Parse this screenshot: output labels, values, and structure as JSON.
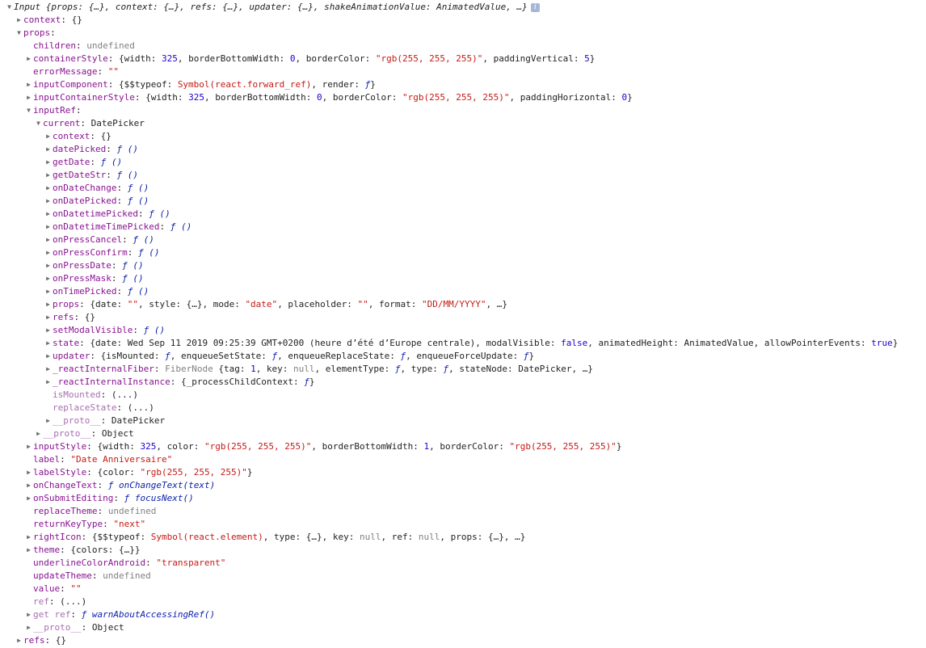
{
  "rows": [
    {
      "d": 0,
      "a": "down",
      "tokens": [
        [
          "i",
          "Input {props: {…}, context: {…}, refs: {…}, updater: {…}, shakeAnimationValue: AnimatedValue, …}"
        ]
      ],
      "info": "i"
    },
    {
      "d": 1,
      "a": "right",
      "tokens": [
        [
          "k",
          "context"
        ],
        [
          "p",
          ": {}"
        ]
      ]
    },
    {
      "d": 1,
      "a": "down",
      "tokens": [
        [
          "k",
          "props"
        ],
        [
          "p",
          ":"
        ]
      ]
    },
    {
      "d": 2,
      "a": "",
      "tokens": [
        [
          "k",
          "children"
        ],
        [
          "p",
          ": "
        ],
        [
          "u",
          "undefined"
        ]
      ]
    },
    {
      "d": 2,
      "a": "right",
      "tokens": [
        [
          "k",
          "containerStyle"
        ],
        [
          "p",
          ": {width: "
        ],
        [
          "n",
          "325"
        ],
        [
          "p",
          ", borderBottomWidth: "
        ],
        [
          "n",
          "0"
        ],
        [
          "p",
          ", borderColor: "
        ],
        [
          "s",
          "\"rgb(255, 255, 255)\""
        ],
        [
          "p",
          ", paddingVertical: "
        ],
        [
          "n",
          "5"
        ],
        [
          "p",
          "}"
        ]
      ]
    },
    {
      "d": 2,
      "a": "",
      "tokens": [
        [
          "k",
          "errorMessage"
        ],
        [
          "p",
          ": "
        ],
        [
          "s",
          "\"\""
        ]
      ]
    },
    {
      "d": 2,
      "a": "right",
      "tokens": [
        [
          "k",
          "inputComponent"
        ],
        [
          "p",
          ": {$$typeof: "
        ],
        [
          "s",
          "Symbol(react.forward_ref)"
        ],
        [
          "p",
          ", render: "
        ],
        [
          "f",
          "ƒ"
        ],
        [
          "p",
          "}"
        ]
      ]
    },
    {
      "d": 2,
      "a": "right",
      "tokens": [
        [
          "k",
          "inputContainerStyle"
        ],
        [
          "p",
          ": {width: "
        ],
        [
          "n",
          "325"
        ],
        [
          "p",
          ", borderBottomWidth: "
        ],
        [
          "n",
          "0"
        ],
        [
          "p",
          ", borderColor: "
        ],
        [
          "s",
          "\"rgb(255, 255, 255)\""
        ],
        [
          "p",
          ", paddingHorizontal: "
        ],
        [
          "n",
          "0"
        ],
        [
          "p",
          "}"
        ]
      ]
    },
    {
      "d": 2,
      "a": "down",
      "tokens": [
        [
          "k",
          "inputRef"
        ],
        [
          "p",
          ":"
        ]
      ]
    },
    {
      "d": 3,
      "a": "down",
      "tokens": [
        [
          "k",
          "current"
        ],
        [
          "p",
          ": DatePicker"
        ]
      ]
    },
    {
      "d": 4,
      "a": "right",
      "tokens": [
        [
          "k",
          "context"
        ],
        [
          "p",
          ": {}"
        ]
      ]
    },
    {
      "d": 4,
      "a": "right",
      "tokens": [
        [
          "k",
          "datePicked"
        ],
        [
          "p",
          ": "
        ],
        [
          "f",
          "ƒ ()"
        ]
      ]
    },
    {
      "d": 4,
      "a": "right",
      "tokens": [
        [
          "k",
          "getDate"
        ],
        [
          "p",
          ": "
        ],
        [
          "f",
          "ƒ ()"
        ]
      ]
    },
    {
      "d": 4,
      "a": "right",
      "tokens": [
        [
          "k",
          "getDateStr"
        ],
        [
          "p",
          ": "
        ],
        [
          "f",
          "ƒ ()"
        ]
      ]
    },
    {
      "d": 4,
      "a": "right",
      "tokens": [
        [
          "k",
          "onDateChange"
        ],
        [
          "p",
          ": "
        ],
        [
          "f",
          "ƒ ()"
        ]
      ]
    },
    {
      "d": 4,
      "a": "right",
      "tokens": [
        [
          "k",
          "onDatePicked"
        ],
        [
          "p",
          ": "
        ],
        [
          "f",
          "ƒ ()"
        ]
      ]
    },
    {
      "d": 4,
      "a": "right",
      "tokens": [
        [
          "k",
          "onDatetimePicked"
        ],
        [
          "p",
          ": "
        ],
        [
          "f",
          "ƒ ()"
        ]
      ]
    },
    {
      "d": 4,
      "a": "right",
      "tokens": [
        [
          "k",
          "onDatetimeTimePicked"
        ],
        [
          "p",
          ": "
        ],
        [
          "f",
          "ƒ ()"
        ]
      ]
    },
    {
      "d": 4,
      "a": "right",
      "tokens": [
        [
          "k",
          "onPressCancel"
        ],
        [
          "p",
          ": "
        ],
        [
          "f",
          "ƒ ()"
        ]
      ]
    },
    {
      "d": 4,
      "a": "right",
      "tokens": [
        [
          "k",
          "onPressConfirm"
        ],
        [
          "p",
          ": "
        ],
        [
          "f",
          "ƒ ()"
        ]
      ]
    },
    {
      "d": 4,
      "a": "right",
      "tokens": [
        [
          "k",
          "onPressDate"
        ],
        [
          "p",
          ": "
        ],
        [
          "f",
          "ƒ ()"
        ]
      ]
    },
    {
      "d": 4,
      "a": "right",
      "tokens": [
        [
          "k",
          "onPressMask"
        ],
        [
          "p",
          ": "
        ],
        [
          "f",
          "ƒ ()"
        ]
      ]
    },
    {
      "d": 4,
      "a": "right",
      "tokens": [
        [
          "k",
          "onTimePicked"
        ],
        [
          "p",
          ": "
        ],
        [
          "f",
          "ƒ ()"
        ]
      ]
    },
    {
      "d": 4,
      "a": "right",
      "tokens": [
        [
          "k",
          "props"
        ],
        [
          "p",
          ": {date: "
        ],
        [
          "s",
          "\"\""
        ],
        [
          "p",
          ", style: {…}, mode: "
        ],
        [
          "s",
          "\"date\""
        ],
        [
          "p",
          ", placeholder: "
        ],
        [
          "s",
          "\"\""
        ],
        [
          "p",
          ", format: "
        ],
        [
          "s",
          "\"DD/MM/YYYY\""
        ],
        [
          "p",
          ", …}"
        ]
      ]
    },
    {
      "d": 4,
      "a": "right",
      "tokens": [
        [
          "k",
          "refs"
        ],
        [
          "p",
          ": {}"
        ]
      ]
    },
    {
      "d": 4,
      "a": "right",
      "tokens": [
        [
          "k",
          "setModalVisible"
        ],
        [
          "p",
          ": "
        ],
        [
          "f",
          "ƒ ()"
        ]
      ]
    },
    {
      "d": 4,
      "a": "right",
      "tokens": [
        [
          "k",
          "state"
        ],
        [
          "p",
          ": {date: Wed Sep 11 2019 09:25:39 GMT+0200 (heure d’été d’Europe centrale), modalVisible: "
        ],
        [
          "b",
          "false"
        ],
        [
          "p",
          ", animatedHeight: AnimatedValue, allowPointerEvents: "
        ],
        [
          "b",
          "true"
        ],
        [
          "p",
          "}"
        ]
      ]
    },
    {
      "d": 4,
      "a": "right",
      "tokens": [
        [
          "k",
          "updater"
        ],
        [
          "p",
          ": {isMounted: "
        ],
        [
          "f",
          "ƒ"
        ],
        [
          "p",
          ", enqueueSetState: "
        ],
        [
          "f",
          "ƒ"
        ],
        [
          "p",
          ", enqueueReplaceState: "
        ],
        [
          "f",
          "ƒ"
        ],
        [
          "p",
          ", enqueueForceUpdate: "
        ],
        [
          "f",
          "ƒ"
        ],
        [
          "p",
          "}"
        ]
      ]
    },
    {
      "d": 4,
      "a": "right",
      "tokens": [
        [
          "k",
          "_reactInternalFiber"
        ],
        [
          "p",
          ": "
        ],
        [
          "u",
          "FiberNode"
        ],
        [
          "p",
          " {tag: "
        ],
        [
          "n",
          "1"
        ],
        [
          "p",
          ", key: "
        ],
        [
          "u",
          "null"
        ],
        [
          "p",
          ", elementType: "
        ],
        [
          "f",
          "ƒ"
        ],
        [
          "p",
          ", type: "
        ],
        [
          "f",
          "ƒ"
        ],
        [
          "p",
          ", stateNode: DatePicker, …}"
        ]
      ]
    },
    {
      "d": 4,
      "a": "right",
      "tokens": [
        [
          "k",
          "_reactInternalInstance"
        ],
        [
          "p",
          ": {_processChildContext: "
        ],
        [
          "f",
          "ƒ"
        ],
        [
          "p",
          "}"
        ]
      ]
    },
    {
      "d": 4,
      "a": "",
      "tokens": [
        [
          "kd",
          "isMounted"
        ],
        [
          "p",
          ": (...)"
        ]
      ]
    },
    {
      "d": 4,
      "a": "",
      "tokens": [
        [
          "kd",
          "replaceState"
        ],
        [
          "p",
          ": (...)"
        ]
      ]
    },
    {
      "d": 4,
      "a": "right",
      "tokens": [
        [
          "kd",
          "__proto__"
        ],
        [
          "p",
          ": DatePicker"
        ]
      ]
    },
    {
      "d": 3,
      "a": "right",
      "tokens": [
        [
          "kd",
          "__proto__"
        ],
        [
          "p",
          ": Object"
        ]
      ]
    },
    {
      "d": 2,
      "a": "right",
      "tokens": [
        [
          "k",
          "inputStyle"
        ],
        [
          "p",
          ": {width: "
        ],
        [
          "n",
          "325"
        ],
        [
          "p",
          ", color: "
        ],
        [
          "s",
          "\"rgb(255, 255, 255)\""
        ],
        [
          "p",
          ", borderBottomWidth: "
        ],
        [
          "n",
          "1"
        ],
        [
          "p",
          ", borderColor: "
        ],
        [
          "s",
          "\"rgb(255, 255, 255)\""
        ],
        [
          "p",
          "}"
        ]
      ]
    },
    {
      "d": 2,
      "a": "",
      "tokens": [
        [
          "k",
          "label"
        ],
        [
          "p",
          ": "
        ],
        [
          "s",
          "\"Date Anniversaire\""
        ]
      ]
    },
    {
      "d": 2,
      "a": "right",
      "tokens": [
        [
          "k",
          "labelStyle"
        ],
        [
          "p",
          ": {color: "
        ],
        [
          "s",
          "\"rgb(255, 255, 255)\""
        ],
        [
          "p",
          "}"
        ]
      ]
    },
    {
      "d": 2,
      "a": "right",
      "tokens": [
        [
          "k",
          "onChangeText"
        ],
        [
          "p",
          ": "
        ],
        [
          "f",
          "ƒ onChangeText(text)"
        ]
      ]
    },
    {
      "d": 2,
      "a": "right",
      "tokens": [
        [
          "k",
          "onSubmitEditing"
        ],
        [
          "p",
          ": "
        ],
        [
          "f",
          "ƒ focusNext()"
        ]
      ]
    },
    {
      "d": 2,
      "a": "",
      "tokens": [
        [
          "k",
          "replaceTheme"
        ],
        [
          "p",
          ": "
        ],
        [
          "u",
          "undefined"
        ]
      ]
    },
    {
      "d": 2,
      "a": "",
      "tokens": [
        [
          "k",
          "returnKeyType"
        ],
        [
          "p",
          ": "
        ],
        [
          "s",
          "\"next\""
        ]
      ]
    },
    {
      "d": 2,
      "a": "right",
      "tokens": [
        [
          "k",
          "rightIcon"
        ],
        [
          "p",
          ": {$$typeof: "
        ],
        [
          "s",
          "Symbol(react.element)"
        ],
        [
          "p",
          ", type: {…}, key: "
        ],
        [
          "u",
          "null"
        ],
        [
          "p",
          ", ref: "
        ],
        [
          "u",
          "null"
        ],
        [
          "p",
          ", props: {…}, …}"
        ]
      ]
    },
    {
      "d": 2,
      "a": "right",
      "tokens": [
        [
          "k",
          "theme"
        ],
        [
          "p",
          ": {colors: {…}}"
        ]
      ]
    },
    {
      "d": 2,
      "a": "",
      "tokens": [
        [
          "k",
          "underlineColorAndroid"
        ],
        [
          "p",
          ": "
        ],
        [
          "s",
          "\"transparent\""
        ]
      ]
    },
    {
      "d": 2,
      "a": "",
      "tokens": [
        [
          "k",
          "updateTheme"
        ],
        [
          "p",
          ": "
        ],
        [
          "u",
          "undefined"
        ]
      ]
    },
    {
      "d": 2,
      "a": "",
      "tokens": [
        [
          "k",
          "value"
        ],
        [
          "p",
          ": "
        ],
        [
          "s",
          "\"\""
        ]
      ]
    },
    {
      "d": 2,
      "a": "",
      "tokens": [
        [
          "kd",
          "ref"
        ],
        [
          "p",
          ": (...)"
        ]
      ]
    },
    {
      "d": 2,
      "a": "right",
      "tokens": [
        [
          "kd",
          "get ref"
        ],
        [
          "p",
          ": "
        ],
        [
          "f",
          "ƒ warnAboutAccessingRef()"
        ]
      ]
    },
    {
      "d": 2,
      "a": "right",
      "tokens": [
        [
          "kd",
          "__proto__"
        ],
        [
          "p",
          ": Object"
        ]
      ]
    },
    {
      "d": 1,
      "a": "right",
      "tokens": [
        [
          "k",
          "refs"
        ],
        [
          "p",
          ": {}"
        ]
      ]
    }
  ]
}
